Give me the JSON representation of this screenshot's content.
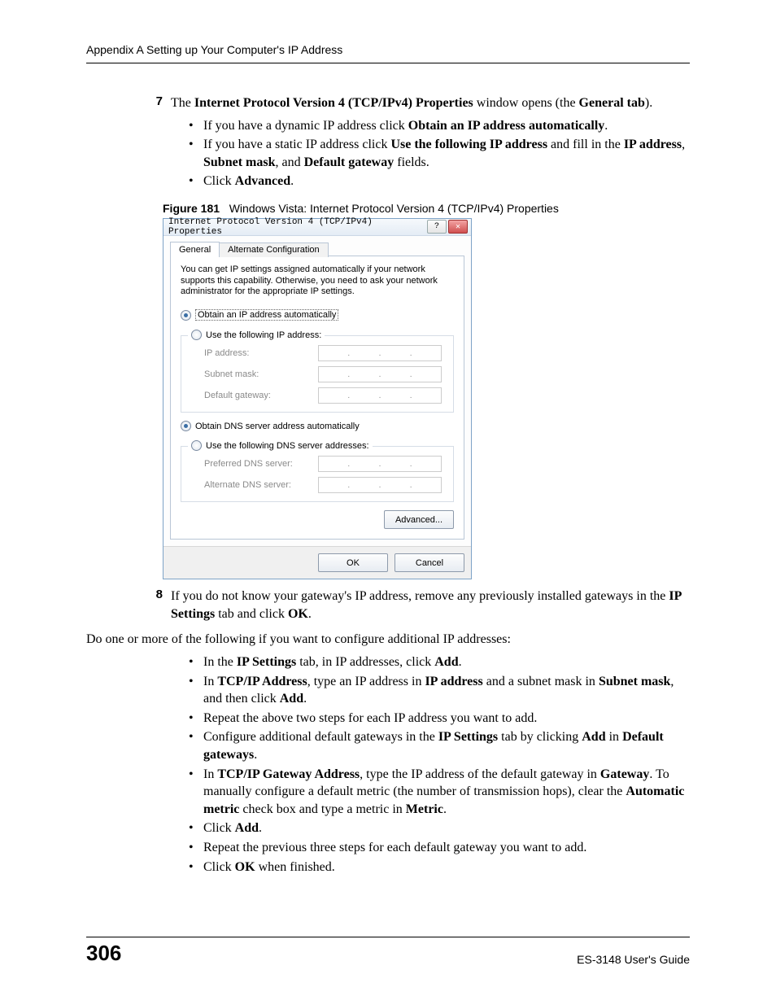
{
  "header": "Appendix A Setting up Your Computer's IP Address",
  "step7": {
    "num": "7",
    "text_parts": [
      "The ",
      "Internet Protocol Version 4 (TCP/IPv4) Properties",
      " window opens (the ",
      "General tab",
      ")."
    ],
    "bullets": [
      {
        "parts": [
          "If you have a dynamic IP address click ",
          "Obtain an IP address automatically",
          "."
        ]
      },
      {
        "parts": [
          "If you have a static IP address click ",
          "Use the following IP address",
          " and fill in the ",
          "IP address",
          ", ",
          "Subnet mask",
          ", and ",
          "Default gateway",
          " fields."
        ]
      },
      {
        "parts": [
          "Click ",
          "Advanced",
          "."
        ]
      }
    ]
  },
  "figure": {
    "label": "Figure 181",
    "caption": "Windows Vista: Internet Protocol Version 4 (TCP/IPv4) Properties"
  },
  "dialog": {
    "title": "Internet Protocol Version 4 (TCP/IPv4) Properties",
    "help_symbol": "?",
    "close_symbol": "✕",
    "tabs": {
      "active": "General",
      "inactive": "Alternate Configuration"
    },
    "intro": "You can get IP settings assigned automatically if your network supports this capability. Otherwise, you need to ask your network administrator for the appropriate IP settings.",
    "ip_group": {
      "auto": "Obtain an IP address automatically",
      "manual": "Use the following IP address:",
      "fields": {
        "ip": "IP address:",
        "mask": "Subnet mask:",
        "gw": "Default gateway:"
      }
    },
    "dns_group": {
      "auto": "Obtain DNS server address automatically",
      "manual": "Use the following DNS server addresses:",
      "fields": {
        "pref": "Preferred DNS server:",
        "alt": "Alternate DNS server:"
      }
    },
    "advanced": "Advanced...",
    "ok": "OK",
    "cancel": "Cancel",
    "dot": "."
  },
  "step8": {
    "num": "8",
    "text_parts": [
      " If you do not know your gateway's IP address, remove any previously installed gateways in the ",
      "IP Settings",
      " tab and click ",
      "OK",
      "."
    ]
  },
  "para": "Do one or more of the following if you want to configure additional IP addresses:",
  "bullets2": [
    {
      "parts": [
        "In the ",
        "IP Settings",
        " tab, in IP addresses, click ",
        "Add",
        "."
      ]
    },
    {
      "parts": [
        "In ",
        "TCP/IP Address",
        ", type an IP address in ",
        "IP address",
        " and a subnet mask in ",
        "Subnet mask",
        ", and then click ",
        "Add",
        "."
      ]
    },
    {
      "parts": [
        "Repeat the above two steps for each IP address you want to add."
      ]
    },
    {
      "parts": [
        "Configure additional default gateways in the ",
        "IP Settings",
        " tab by clicking ",
        "Add",
        " in ",
        "Default gateways",
        "."
      ]
    },
    {
      "parts": [
        "In ",
        "TCP/IP Gateway Address",
        ", type the IP address of the default gateway in ",
        "Gateway",
        ". To manually configure a default metric (the number of transmission hops), clear the ",
        "Automatic metric",
        " check box and type a metric in ",
        "Metric",
        "."
      ]
    },
    {
      "parts": [
        "Click ",
        "Add",
        "."
      ]
    },
    {
      "parts": [
        "Repeat the previous three steps for each default gateway you want to add."
      ]
    },
    {
      "parts": [
        "Click ",
        "OK",
        " when finished."
      ]
    }
  ],
  "footer": {
    "page": "306",
    "guide": "ES-3148 User's Guide"
  }
}
